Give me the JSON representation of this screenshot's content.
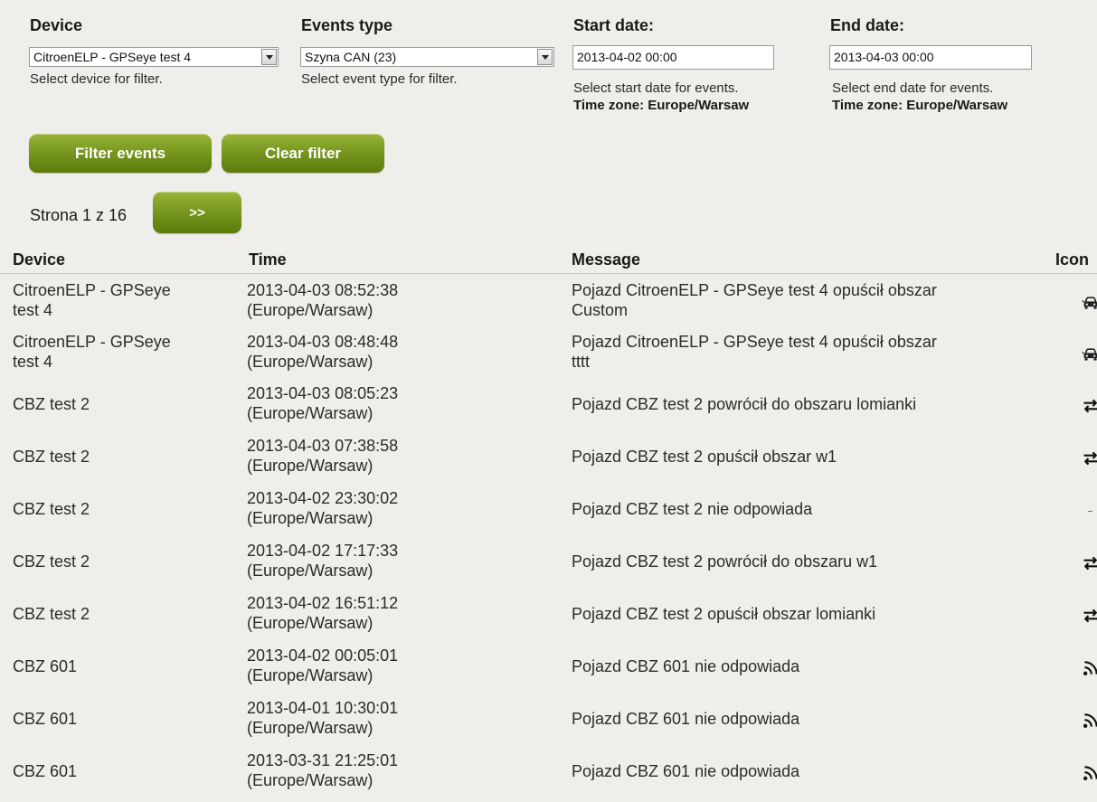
{
  "filters": {
    "device": {
      "label": "Device",
      "value": "CitroenELP - GPSeye test 4",
      "hint": "Select device for filter."
    },
    "events_type": {
      "label": "Events type",
      "value": "Szyna CAN (23)",
      "hint": "Select event type for filter."
    },
    "start_date": {
      "label": "Start date:",
      "value": "2013-04-02 00:00",
      "hint": "Select start date for events.",
      "tz": "Time zone: Europe/Warsaw"
    },
    "end_date": {
      "label": "End date:",
      "value": "2013-04-03 00:00",
      "hint": "Select end date for events.",
      "tz": "Time zone: Europe/Warsaw"
    }
  },
  "buttons": {
    "filter": "Filter events",
    "clear": "Clear filter",
    "next": ">>"
  },
  "pagination": {
    "text": "Strona 1 z 16"
  },
  "table": {
    "headers": {
      "device": "Device",
      "time": "Time",
      "message": "Message",
      "icon": "Icon"
    },
    "rows": [
      {
        "device": [
          "CitroenELP - GPSeye",
          "test 4"
        ],
        "time": [
          "2013-04-03 08:52:38",
          "(Europe/Warsaw)"
        ],
        "message": [
          "Pojazd CitroenELP - GPSeye test 4 opuścił obszar",
          "Custom"
        ],
        "icon": "car-icon"
      },
      {
        "device": [
          "CitroenELP - GPSeye",
          "test 4"
        ],
        "time": [
          "2013-04-03 08:48:48",
          "(Europe/Warsaw)"
        ],
        "message": [
          "Pojazd CitroenELP - GPSeye test 4 opuścił obszar",
          "tttt"
        ],
        "icon": "car-icon"
      },
      {
        "device": [
          "CBZ test 2"
        ],
        "time": [
          "2013-04-03 08:05:23",
          "(Europe/Warsaw)"
        ],
        "message": [
          "Pojazd CBZ test 2 powrócił do obszaru lomianki"
        ],
        "icon": "swap-arrows-icon"
      },
      {
        "device": [
          "CBZ test 2"
        ],
        "time": [
          "2013-04-03 07:38:58",
          "(Europe/Warsaw)"
        ],
        "message": [
          "Pojazd CBZ test 2 opuścił obszar w1"
        ],
        "icon": "swap-arrows-icon"
      },
      {
        "device": [
          "CBZ test 2"
        ],
        "time": [
          "2013-04-02 23:30:02",
          "(Europe/Warsaw)"
        ],
        "message": [
          "Pojazd CBZ test 2 nie odpowiada"
        ],
        "icon": "dash-icon"
      },
      {
        "device": [
          "CBZ test 2"
        ],
        "time": [
          "2013-04-02 17:17:33",
          "(Europe/Warsaw)"
        ],
        "message": [
          "Pojazd CBZ test 2 powrócił do obszaru w1"
        ],
        "icon": "swap-arrows-icon"
      },
      {
        "device": [
          "CBZ test 2"
        ],
        "time": [
          "2013-04-02 16:51:12",
          "(Europe/Warsaw)"
        ],
        "message": [
          "Pojazd CBZ test 2 opuścił obszar lomianki"
        ],
        "icon": "swap-arrows-icon"
      },
      {
        "device": [
          "CBZ 601"
        ],
        "time": [
          "2013-04-02 00:05:01",
          "(Europe/Warsaw)"
        ],
        "message": [
          "Pojazd CBZ 601 nie odpowiada"
        ],
        "icon": "signal-icon"
      },
      {
        "device": [
          "CBZ 601"
        ],
        "time": [
          "2013-04-01 10:30:01",
          "(Europe/Warsaw)"
        ],
        "message": [
          "Pojazd CBZ 601 nie odpowiada"
        ],
        "icon": "signal-icon"
      },
      {
        "device": [
          "CBZ 601"
        ],
        "time": [
          "2013-03-31 21:25:01",
          "(Europe/Warsaw)"
        ],
        "message": [
          "Pojazd CBZ 601 nie odpowiada"
        ],
        "icon": "signal-icon"
      }
    ]
  }
}
